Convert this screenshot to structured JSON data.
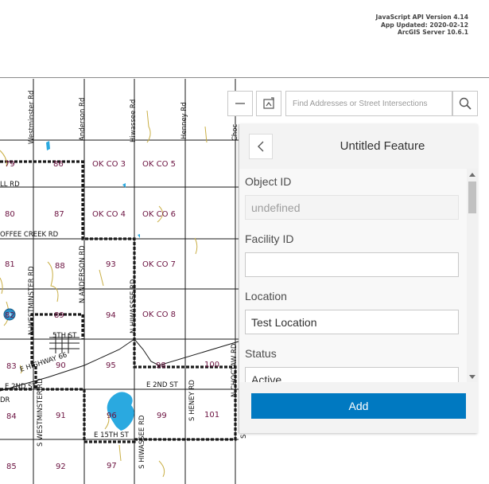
{
  "version_info": {
    "api": "JavaScript API Version 4.14",
    "app_updated": "App Updated: 2020-02-12",
    "server": "ArcGIS Server 10.6.1"
  },
  "map": {
    "roads": {
      "westminster_rd": "Westminster Rd",
      "anderson_rd": "Anderson Rd",
      "hiwassee_rd": "Hiwassee Rd",
      "henney_rd": "Henney Rd",
      "choctaw_rd": "Choc",
      "hall_rd": "LL RD",
      "coffee_creek_rd": "OFFEE CREEK RD",
      "n_westminster_rd": "N WESTMINSTER RD",
      "n_anderson_rd": "N ANDERSON RD",
      "n_hiwassee_rd": "N HIWASSEE RD",
      "n_choctaw_rd": "N CHOCTAW RD",
      "fifth_st": "5TH ST",
      "e_highway_66": "E HIGHWAY 66",
      "e_2nd_st_left": "E 2ND ST",
      "e_2nd_st_right": "E 2ND ST",
      "dr_label": "DR",
      "s_westminster_rd": "S WESTMINSTER RD",
      "s_hiwassee_rd": "S HIWASSEE RD",
      "s_henney_rd": "S HENEY RD",
      "e_15th_st": "E 15TH ST",
      "s_choctaw": "S"
    },
    "sections": {
      "s79": "79",
      "s86": "86",
      "okco3": "OK CO 3",
      "okco5": "OK CO 5",
      "s80": "80",
      "s87": "87",
      "okco4": "OK CO 4",
      "okco6": "OK CO 6",
      "s81": "81",
      "s88": "88",
      "s93": "93",
      "okco7": "OK CO 7",
      "s82": "82",
      "s89": "89",
      "s94": "94",
      "okco8": "OK CO 8",
      "s83": "83",
      "s90": "90",
      "s95": "95",
      "s98": "98",
      "s100": "100",
      "s84": "84",
      "s91": "91",
      "s96": "96",
      "s99": "99",
      "s101": "101",
      "s85": "85",
      "s92": "92",
      "s97": "97"
    },
    "colors": {
      "water": "#2aa9e0",
      "section_label": "#6b1240",
      "creek": "#c9ae43",
      "marker": "#2a8fc7"
    }
  },
  "toolbar": {
    "zoom_out_icon": "minus-icon",
    "extent_icon": "map-extent-icon",
    "search_placeholder": "Find Addresses or Street Intersections",
    "search_icon": "search-icon"
  },
  "panel": {
    "title": "Untitled Feature",
    "back_icon": "chevron-left-icon",
    "fields": [
      {
        "label": "Object ID",
        "value": "undefined"
      },
      {
        "label": "Facility ID",
        "value": ""
      },
      {
        "label": "Location",
        "value": "Test Location"
      },
      {
        "label": "Status",
        "value": "Active"
      }
    ],
    "add_label": "Add",
    "accent": "#0079c1"
  }
}
